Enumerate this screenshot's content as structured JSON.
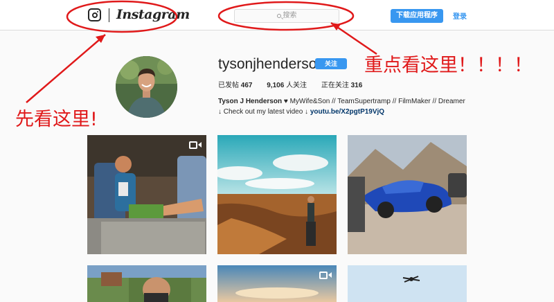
{
  "header": {
    "logo_text": "Instagram",
    "search_placeholder": "搜索",
    "download_label": "下载应用程序",
    "login_label": "登录"
  },
  "profile": {
    "username": "tysonjhenderson",
    "follow_label": "关注",
    "stats": {
      "posts_label": "已发帖",
      "posts_value": "467",
      "followers_value": "9,106",
      "followers_label": "人关注",
      "following_label": "正在关注",
      "following_value": "316"
    },
    "bio": {
      "name": "Tyson J Henderson",
      "heart": "♥",
      "line1": "MyWife&Son // TeamSupertramp // FilmMaker // Dreamer",
      "line2": "↓ Check out my latest video ↓",
      "link": "youtu.be/X2pgtP19VjQ"
    }
  },
  "annotations": {
    "left_note": "先看这里!",
    "right_note": "重点看这里！！！！"
  },
  "colors": {
    "accent": "#3897f0",
    "annotation": "#e0191a"
  }
}
